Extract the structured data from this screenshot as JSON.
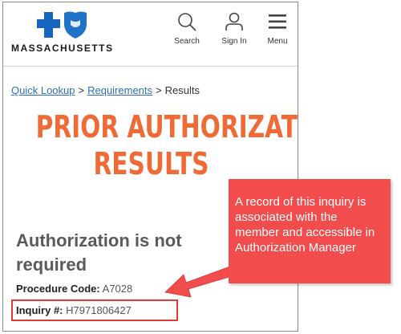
{
  "header": {
    "logo_text": "MASSACHUSETTS",
    "nav": [
      {
        "label": "Search",
        "icon": "search-icon"
      },
      {
        "label": "Sign In",
        "icon": "user-icon"
      },
      {
        "label": "Menu",
        "icon": "hamburger-icon"
      }
    ],
    "brand_color": "#1565c0"
  },
  "breadcrumb": {
    "items": [
      {
        "label": "Quick Lookup"
      },
      {
        "label": "Requirements"
      },
      {
        "label": "Results"
      }
    ],
    "separator": ">"
  },
  "page": {
    "title_line1": "PRIOR AUTHORIZATION",
    "title_line2": "RESULTS",
    "title_color": "#f06a35"
  },
  "result": {
    "heading": "Authorization is not required",
    "procedure_label": "Procedure Code:",
    "procedure_value": "A7028",
    "inquiry_label": "Inquiry #:",
    "inquiry_value": "H7971806427"
  },
  "callout": {
    "text": "A record of this inquiry is associated with the member and accessible in Authorization Manager",
    "color": "#f24c4c"
  }
}
